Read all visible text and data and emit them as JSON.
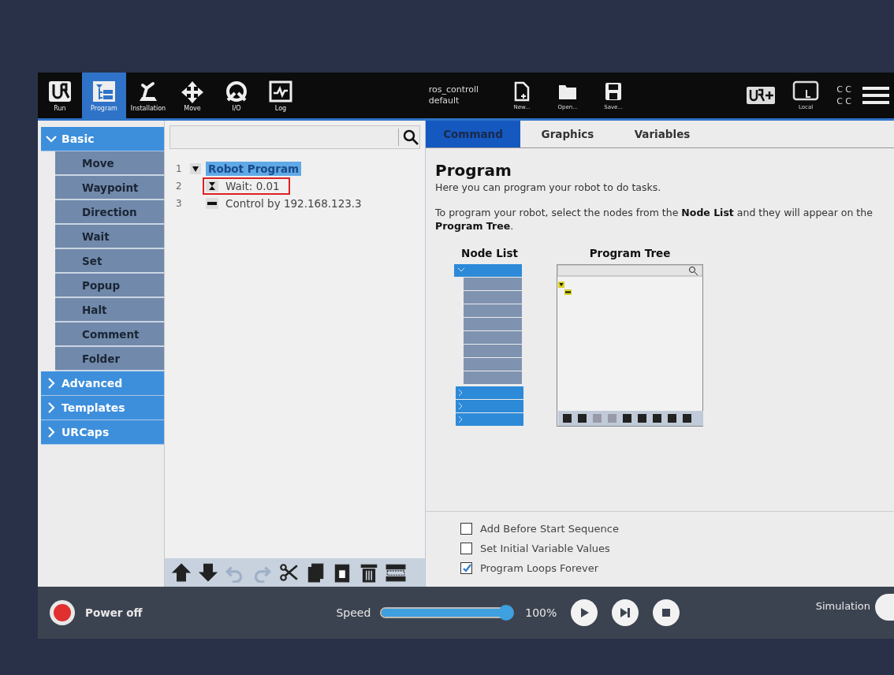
{
  "header": {
    "nav_tabs": [
      {
        "kind": "run",
        "label": "Run",
        "selected": false
      },
      {
        "kind": "program",
        "label": "Program",
        "selected": true
      },
      {
        "kind": "installation",
        "label": "Installation",
        "selected": false
      },
      {
        "kind": "move",
        "label": "Move",
        "selected": false
      },
      {
        "kind": "io",
        "label": "I/O",
        "selected": false
      },
      {
        "kind": "log",
        "label": "Log",
        "selected": false
      }
    ],
    "program_name": "ros_controll",
    "installation_name": "default",
    "file_buttons": [
      {
        "kind": "new",
        "label": "New..."
      },
      {
        "kind": "open",
        "label": "Open..."
      },
      {
        "kind": "save",
        "label": "Save..."
      }
    ],
    "mode_label": "Local",
    "status_letters": [
      "C C",
      "C C"
    ]
  },
  "sidebar": {
    "groups": [
      {
        "label": "Basic",
        "expanded": true,
        "items": [
          "Move",
          "Waypoint",
          "Direction",
          "Wait",
          "Set",
          "Popup",
          "Halt",
          "Comment",
          "Folder"
        ]
      },
      {
        "label": "Advanced",
        "expanded": false
      },
      {
        "label": "Templates",
        "expanded": false
      },
      {
        "label": "URCaps",
        "expanded": false
      }
    ]
  },
  "tree": {
    "nodes": [
      {
        "line": "1",
        "label": "Robot Program",
        "selected": true,
        "expanded": true,
        "children": [
          {
            "line": "2",
            "kind": "wait",
            "label": "Wait: 0.01",
            "selected": false,
            "annotated": true
          },
          {
            "line": "3",
            "kind": "urcap",
            "label": "Control by 192.168.123.3",
            "selected": false,
            "annotated": false
          }
        ]
      }
    ],
    "toolbar": [
      {
        "kind": "up",
        "disabled": false
      },
      {
        "kind": "down",
        "disabled": false
      },
      {
        "kind": "undo",
        "disabled": true
      },
      {
        "kind": "redo",
        "disabled": true
      },
      {
        "kind": "cut",
        "disabled": false
      },
      {
        "kind": "copy",
        "disabled": false
      },
      {
        "kind": "paste",
        "disabled": false
      },
      {
        "kind": "delete",
        "disabled": false
      },
      {
        "kind": "suppress",
        "disabled": false
      }
    ]
  },
  "right_panel": {
    "tabs": [
      {
        "label": "Command",
        "selected": true
      },
      {
        "label": "Graphics",
        "selected": false
      },
      {
        "label": "Variables",
        "selected": false
      }
    ],
    "title": "Program",
    "intro": "Here you can program your robot to do tasks.",
    "instructions": "To program your robot, select the nodes from the **Node List** and they will appear on the **Program Tree**.",
    "node_list_heading": "Node List",
    "program_tree_heading": "Program Tree",
    "options": [
      {
        "label": "Add Before Start Sequence",
        "checked": false
      },
      {
        "label": "Set Initial Variable Values",
        "checked": false
      },
      {
        "label": "Program Loops Forever",
        "checked": true
      }
    ]
  },
  "footer": {
    "power_label": "Power off",
    "speed_label": "Speed",
    "speed": {
      "level": 1.0
    },
    "speed_reading": "100%",
    "simulation_label": "Simulation"
  }
}
